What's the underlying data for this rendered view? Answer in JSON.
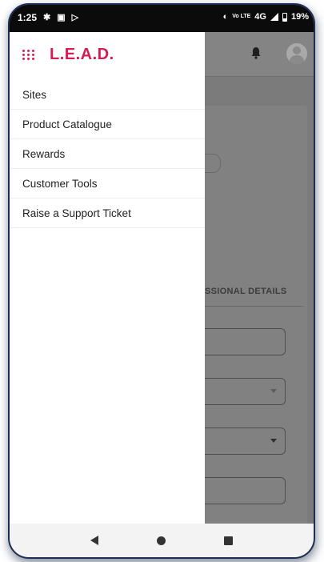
{
  "status_bar": {
    "time": "1:25",
    "network_label": "4G",
    "volte_label": "Vo LTE",
    "battery_text": "19%",
    "icons": [
      "gear-icon",
      "screen-record-icon",
      "play-store-icon",
      "key-icon",
      "signal-icon",
      "battery-icon"
    ]
  },
  "drawer": {
    "brand": "L.E.A.D.",
    "brand_color": "#d81b53",
    "menu_items": [
      {
        "label": "Sites"
      },
      {
        "label": "Product Catalogue"
      },
      {
        "label": "Rewards"
      },
      {
        "label": "Customer Tools"
      },
      {
        "label": "Raise a Support Ticket"
      }
    ]
  },
  "background_app": {
    "tab_label": "SSIONAL DETAILS",
    "icons": [
      "bell-icon",
      "avatar"
    ]
  },
  "nav_bar": {
    "icons": [
      "back-icon",
      "home-icon",
      "recents-icon"
    ]
  }
}
